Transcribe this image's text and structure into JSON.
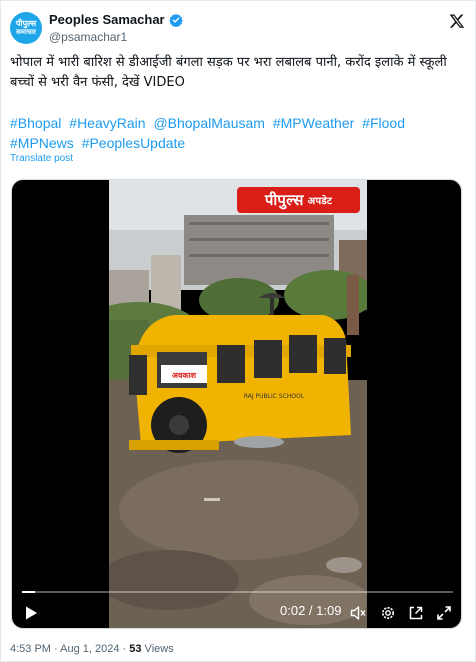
{
  "author": {
    "avatar_line1": "पीपुल्स",
    "avatar_line2": "समाचार",
    "display_name": "Peoples Samachar",
    "handle": "@psamachar1",
    "verified": true
  },
  "tweet": {
    "text": "भोपाल में भारी बारिश से डीआईजी बंगला सड़क पर भरा लबालब पानी, करोंद इलाके में स्कूली बच्चों से भरी वैन फंसी, देखें VIDEO",
    "hashtags": [
      "#Bhopal",
      "#HeavyRain",
      "@BhopalMausam",
      "#MPWeather",
      "#Flood",
      "#MPNews",
      "#PeoplesUpdate"
    ],
    "translate_label": "Translate post"
  },
  "video": {
    "brand_badge_name": "पीपुल्स",
    "brand_badge_tag": "अपडेट",
    "van_sign": "अवकाश",
    "van_school": "RAJ PUBLIC SCHOOL",
    "current_time": "0:02",
    "duration": "1:09",
    "time_display": "0:02 / 1:09",
    "progress_fraction": 0.03
  },
  "meta": {
    "timestamp": "4:53 PM · Aug 1, 2024 · ",
    "views_count": "53",
    "views_label": " Views"
  },
  "colors": {
    "link": "#1d9bf0",
    "muted": "#536471",
    "badge_red": "#d91e18",
    "avatar_blue": "#1ea6e8"
  },
  "icons": [
    "verified-badge-icon",
    "x-logo-icon",
    "play-icon",
    "volume-icon",
    "settings-gear-icon",
    "pip-icon",
    "fullscreen-icon"
  ]
}
